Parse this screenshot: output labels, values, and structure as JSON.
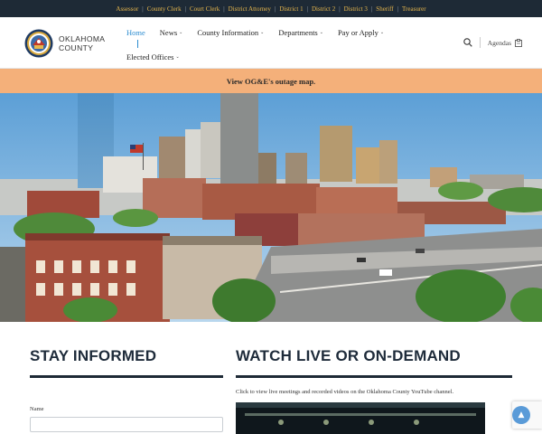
{
  "topbar": {
    "links": [
      "Assessor",
      "County Clerk",
      "Court Clerk",
      "District Attorney",
      "District 1",
      "District 2",
      "District 3",
      "Sheriff",
      "Treasurer"
    ]
  },
  "header": {
    "logo_line1": "OKLAHOMA",
    "logo_line2": "COUNTY",
    "nav": {
      "home": "Home",
      "news": "News",
      "county_information": "County Information",
      "departments": "Departments",
      "pay_or_apply": "Pay or Apply",
      "elected_offices": "Elected Offices"
    },
    "agendas": "Agendas",
    "search_icon": "search-icon"
  },
  "alert": {
    "text": "View OG&E's outage map."
  },
  "stay_informed": {
    "heading": "STAY INFORMED",
    "name_label": "Name"
  },
  "watch_live": {
    "heading": "WATCH LIVE OR ON-DEMAND",
    "description": "Click to view live meetings and recorded videos on the Oklahoma County YouTube channel."
  },
  "colors": {
    "topbar_bg": "#1e2a36",
    "topbar_link": "#e7b74d",
    "nav_active": "#2a8bd0",
    "alert_bg": "#f4b07a",
    "heading": "#1e2b3a"
  }
}
